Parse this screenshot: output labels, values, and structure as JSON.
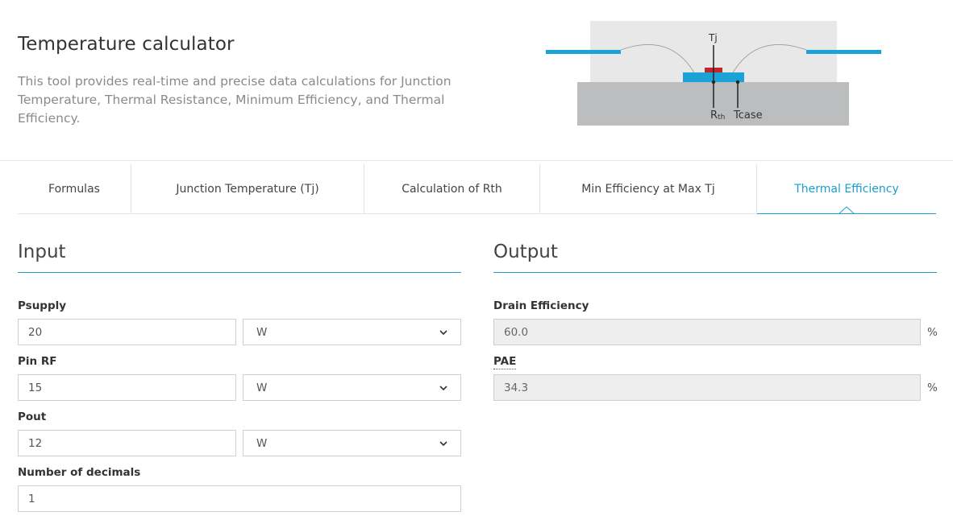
{
  "header": {
    "title": "Temperature calculator",
    "description": "This tool provides real-time and precise data calculations for Junction Temperature, Thermal Resistance, Minimum Efficiency, and Thermal Efficiency."
  },
  "diagram": {
    "tj_label": "Tj",
    "rth_label_main": "R",
    "rth_label_sub": "th",
    "tcase_label": "Tcase"
  },
  "tabs": [
    {
      "label": "Formulas",
      "active": false
    },
    {
      "label": "Junction Temperature (Tj)",
      "active": false
    },
    {
      "label": "Calculation of Rth",
      "active": false
    },
    {
      "label": "Min Efficiency at Max Tj",
      "active": false
    },
    {
      "label": "Thermal Efficiency",
      "active": true
    }
  ],
  "input": {
    "heading": "Input",
    "psupply": {
      "label": "Psupply",
      "value": "20",
      "unit": "W"
    },
    "pin_rf": {
      "label": "Pin RF",
      "value": "15",
      "unit": "W"
    },
    "pout": {
      "label": "Pout",
      "value": "12",
      "unit": "W"
    },
    "decimals": {
      "label": "Number of decimals",
      "value": "1"
    }
  },
  "output": {
    "heading": "Output",
    "drain_efficiency": {
      "label": "Drain Efficiency",
      "value": "60.0",
      "unit": "%"
    },
    "pae": {
      "label": "PAE",
      "value": "34.3",
      "unit": "%"
    }
  },
  "colors": {
    "accent": "#199ecf",
    "chip_red": "#c0272d",
    "chip_blue": "#1ba3d8"
  }
}
